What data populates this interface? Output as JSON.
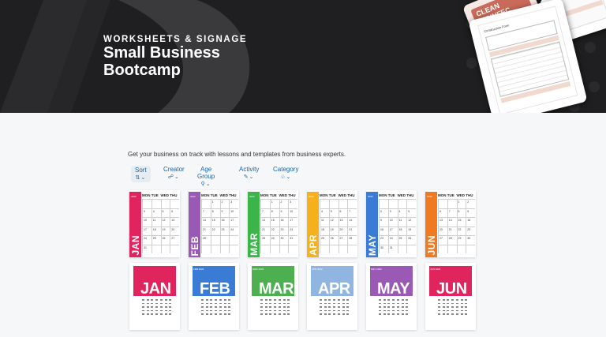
{
  "hero": {
    "eyebrow": "WORKSHEETS & SIGNAGE",
    "title_line1": "Small Business",
    "title_line2": "Bootcamp",
    "sign_text1": "CLEAN",
    "sign_text2": "DISINFEC",
    "form_title": "Construction Form"
  },
  "intro": "Get your business on track with lessons and templates from business experts.",
  "filters": [
    {
      "label": "Sort",
      "icon": "sort-icon"
    },
    {
      "label": "Creator",
      "icon": "creator-icon"
    },
    {
      "label": "Age Group",
      "icon": "age-group-icon"
    },
    {
      "label": "Activity",
      "icon": "activity-icon"
    },
    {
      "label": "Category",
      "icon": "category-icon"
    }
  ],
  "day_headers": [
    "MON",
    "TUE",
    "WED",
    "THU"
  ],
  "cards_row1": [
    {
      "month": "JAN",
      "color": "#e0245e",
      "year": "2022",
      "rows": [
        [
          "",
          "",
          "",
          ""
        ],
        [
          "3",
          "4",
          "5",
          "6"
        ],
        [
          "10",
          "11",
          "12",
          "13"
        ],
        [
          "17",
          "18",
          "19",
          "20"
        ],
        [
          "24",
          "25",
          "26",
          "27"
        ],
        [
          "31",
          "",
          "",
          ""
        ]
      ]
    },
    {
      "month": "FEB",
      "color": "#9b59b6",
      "year": "2022",
      "rows": [
        [
          "",
          "1",
          "2",
          "3"
        ],
        [
          "7",
          "8",
          "9",
          "10"
        ],
        [
          "14",
          "15",
          "16",
          "17"
        ],
        [
          "21",
          "22",
          "23",
          "24"
        ],
        [
          "28",
          "",
          "",
          ""
        ],
        [
          "",
          "",
          "",
          ""
        ]
      ]
    },
    {
      "month": "MAR",
      "color": "#3bb54a",
      "year": "2022",
      "rows": [
        [
          "",
          "1",
          "2",
          "3"
        ],
        [
          "7",
          "8",
          "9",
          "10"
        ],
        [
          "14",
          "15",
          "16",
          "17"
        ],
        [
          "21",
          "22",
          "23",
          "24"
        ],
        [
          "28",
          "29",
          "30",
          "31"
        ],
        [
          "",
          "",
          "",
          ""
        ]
      ]
    },
    {
      "month": "APR",
      "color": "#f5b01b",
      "year": "2022",
      "rows": [
        [
          "",
          "",
          "",
          ""
        ],
        [
          "4",
          "5",
          "6",
          "7"
        ],
        [
          "11",
          "12",
          "13",
          "14"
        ],
        [
          "18",
          "19",
          "20",
          "21"
        ],
        [
          "25",
          "26",
          "27",
          "28"
        ],
        [
          "",
          "",
          "",
          ""
        ]
      ]
    },
    {
      "month": "MAY",
      "color": "#3a7bd5",
      "year": "2022",
      "rows": [
        [
          "",
          "",
          "",
          ""
        ],
        [
          "2",
          "3",
          "4",
          "5"
        ],
        [
          "9",
          "10",
          "11",
          "12"
        ],
        [
          "16",
          "17",
          "18",
          "19"
        ],
        [
          "23",
          "24",
          "25",
          "26"
        ],
        [
          "30",
          "31",
          "",
          ""
        ]
      ]
    },
    {
      "month": "JUN",
      "color": "#f07a21",
      "year": "2022",
      "rows": [
        [
          "",
          "",
          "1",
          "2"
        ],
        [
          "6",
          "7",
          "8",
          "9"
        ],
        [
          "13",
          "14",
          "15",
          "16"
        ],
        [
          "20",
          "21",
          "22",
          "23"
        ],
        [
          "27",
          "28",
          "29",
          "30"
        ],
        [
          "",
          "",
          "",
          ""
        ]
      ]
    }
  ],
  "cards_row2": [
    {
      "month": "JAN",
      "color": "#e0245e",
      "tiny": ""
    },
    {
      "month": "FEB",
      "color": "#3a7bd5",
      "tiny": "FEB 2022"
    },
    {
      "month": "MAR",
      "color": "#4caf50",
      "tiny": "MAR 2022"
    },
    {
      "month": "APR",
      "color": "#8fb5e0",
      "tiny": "APR 2022"
    },
    {
      "month": "MAY",
      "color": "#9b59b6",
      "tiny": "MAY 2022"
    },
    {
      "month": "JUN",
      "color": "#e0245e",
      "tiny": "JUN 2022"
    }
  ]
}
